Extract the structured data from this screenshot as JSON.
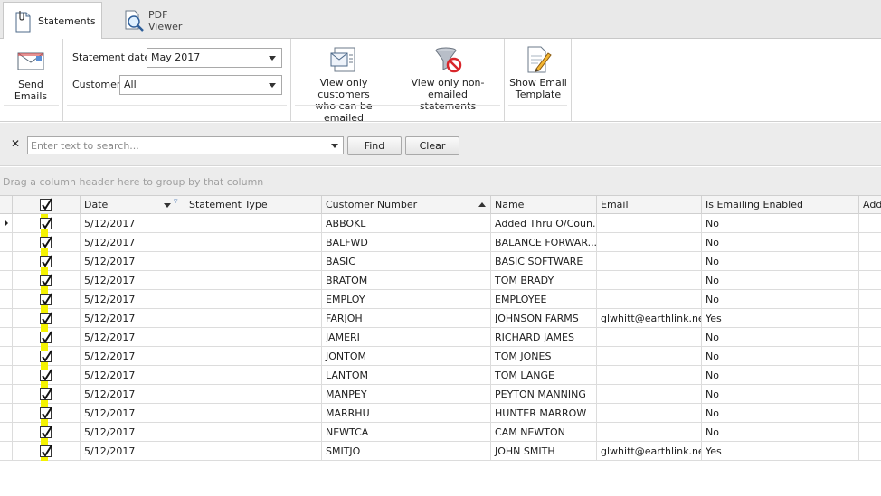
{
  "tabs": [
    {
      "label": "Statements",
      "icon": "statement-clip-icon",
      "active": true
    },
    {
      "label": "PDF Viewer",
      "icon": "pdf-magnifier-icon",
      "active": false
    }
  ],
  "ribbon": {
    "send_emails": "Send Emails",
    "statement_date_label": "Statement date:",
    "statement_date_value": "May 2017",
    "customer_label": "Customer:",
    "customer_value": "All",
    "view_emailable_line1": "View only customers",
    "view_emailable_line2": "who can be emailed",
    "view_nonemailed_line1": "View only non-emailed",
    "view_nonemailed_line2": "statements",
    "show_template_line1": "Show Email",
    "show_template_line2": "Template"
  },
  "search": {
    "placeholder": "Enter text to search...",
    "find": "Find",
    "clear": "Clear",
    "close_glyph": "✕"
  },
  "group_panel_text": "Drag a column header here to group by that column",
  "columns": {
    "date": "Date",
    "statement_type": "Statement Type",
    "customer_number": "Customer Number",
    "name": "Name",
    "email": "Email",
    "is_emailing_enabled": "Is Emailing Enabled",
    "additional": "Addi"
  },
  "rows": [
    {
      "date": "5/12/2017",
      "type": "",
      "num": "ABBOKL",
      "name": "Added Thru O/Coun...",
      "email": "",
      "enabled": "No",
      "checked": true,
      "current": true
    },
    {
      "date": "5/12/2017",
      "type": "",
      "num": "BALFWD",
      "name": "BALANCE FORWAR...",
      "email": "",
      "enabled": "No",
      "checked": true
    },
    {
      "date": "5/12/2017",
      "type": "",
      "num": "BASIC",
      "name": "BASIC SOFTWARE",
      "email": "",
      "enabled": "No",
      "checked": true
    },
    {
      "date": "5/12/2017",
      "type": "",
      "num": "BRATOM",
      "name": "TOM BRADY",
      "email": "",
      "enabled": "No",
      "checked": true
    },
    {
      "date": "5/12/2017",
      "type": "",
      "num": "EMPLOY",
      "name": "EMPLOYEE",
      "email": "",
      "enabled": "No",
      "checked": true
    },
    {
      "date": "5/12/2017",
      "type": "",
      "num": "FARJOH",
      "name": "JOHNSON FARMS",
      "email": "glwhitt@earthlink.net",
      "enabled": "Yes",
      "checked": true
    },
    {
      "date": "5/12/2017",
      "type": "",
      "num": "JAMERI",
      "name": "RICHARD JAMES",
      "email": "",
      "enabled": "No",
      "checked": true
    },
    {
      "date": "5/12/2017",
      "type": "",
      "num": "JONTOM",
      "name": "TOM JONES",
      "email": "",
      "enabled": "No",
      "checked": true
    },
    {
      "date": "5/12/2017",
      "type": "",
      "num": "LANTOM",
      "name": "TOM LANGE",
      "email": "",
      "enabled": "No",
      "checked": true
    },
    {
      "date": "5/12/2017",
      "type": "",
      "num": "MANPEY",
      "name": "PEYTON MANNING",
      "email": "",
      "enabled": "No",
      "checked": true
    },
    {
      "date": "5/12/2017",
      "type": "",
      "num": "MARRHU",
      "name": "HUNTER MARROW",
      "email": "",
      "enabled": "No",
      "checked": true
    },
    {
      "date": "5/12/2017",
      "type": "",
      "num": "NEWTCA",
      "name": "CAM NEWTON",
      "email": "",
      "enabled": "No",
      "checked": true
    },
    {
      "date": "5/12/2017",
      "type": "",
      "num": "SMITJO",
      "name": "JOHN SMITH",
      "email": "glwhitt@earthlink.net",
      "enabled": "Yes",
      "checked": true
    }
  ],
  "colors": {
    "highlight": "#f4f200",
    "tab_bg": "#e9e9e9",
    "toolbar_bg": "#ececec"
  }
}
